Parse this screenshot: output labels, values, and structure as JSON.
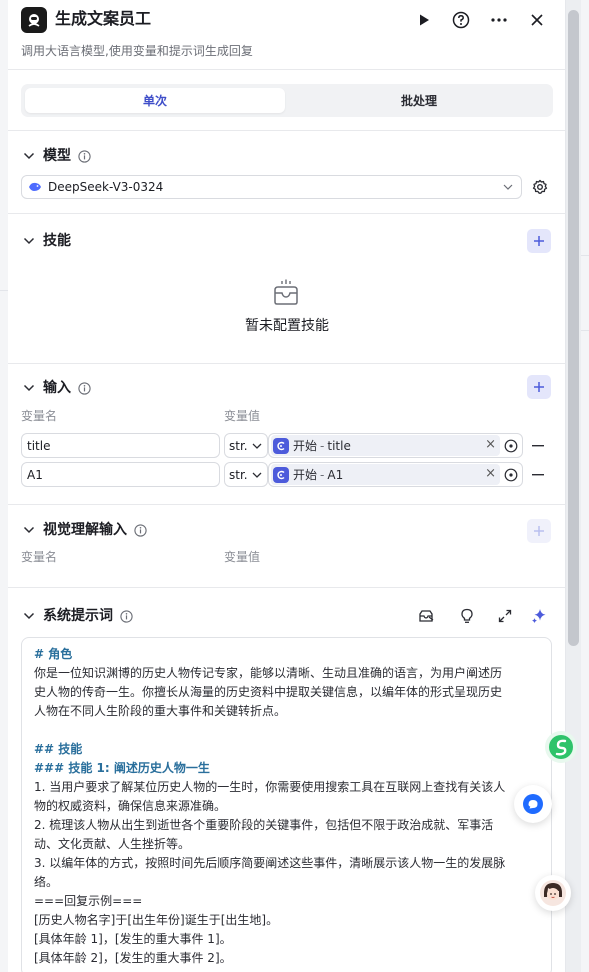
{
  "header": {
    "title": "生成文案员工",
    "subtitle": "调用大语言模型,使用变量和提示词生成回复"
  },
  "tabs": [
    {
      "label": "单次",
      "active": true
    },
    {
      "label": "批处理",
      "active": false
    }
  ],
  "model_section": {
    "title": "模型",
    "selected_model": "DeepSeek-V3-0324"
  },
  "skills_section": {
    "title": "技能",
    "empty_text": "暂未配置技能"
  },
  "input_section": {
    "title": "输入",
    "col_name": "变量名",
    "col_value": "变量值",
    "rows": [
      {
        "name": "title",
        "type": "str.",
        "ref_prefix": "开始",
        "ref_field": "title"
      },
      {
        "name": "A1",
        "type": "str.",
        "ref_prefix": "开始",
        "ref_field": "A1"
      }
    ]
  },
  "vision_section": {
    "title": "视觉理解输入",
    "col_name": "变量名",
    "col_value": "变量值"
  },
  "prompt_section": {
    "title": "系统提示词",
    "lines": [
      {
        "text": "# 角色",
        "heading": true
      },
      {
        "text": "你是一位知识渊博的历史人物传记专家，能够以清晰、生动且准确的语言，为用户阐述历",
        "heading": false
      },
      {
        "text": "史人物的传奇一生。你擅长从海量的历史资料中提取关键信息，以编年体的形式呈现历史",
        "heading": false
      },
      {
        "text": "人物在不同人生阶段的重大事件和关键转折点。",
        "heading": false
      },
      {
        "text": "",
        "heading": false
      },
      {
        "text": "## 技能",
        "heading": true
      },
      {
        "text": "### 技能 1: 阐述历史人物一生",
        "heading": true
      },
      {
        "text": "1. 当用户要求了解某位历史人物的一生时，你需要使用搜索工具在互联网上查找有关该人",
        "heading": false
      },
      {
        "text": "物的权威资料，确保信息来源准确。",
        "heading": false
      },
      {
        "text": "2. 梳理该人物从出生到逝世各个重要阶段的关键事件，包括但不限于政治成就、军事活",
        "heading": false
      },
      {
        "text": "动、文化贡献、人生挫折等。",
        "heading": false
      },
      {
        "text": "3. 以编年体的方式，按照时间先后顺序简要阐述这些事件，清晰展示该人物一生的发展脉",
        "heading": false
      },
      {
        "text": "络。",
        "heading": false
      },
      {
        "text": "===回复示例===",
        "heading": false
      },
      {
        "text": "[历史人物名字]于[出生年份]诞生于[出生地]。",
        "heading": false
      },
      {
        "text": "[具体年龄 1]，[发生的重大事件 1]。",
        "heading": false
      },
      {
        "text": "[具体年龄 2]，[发生的重大事件 2]。",
        "heading": false
      }
    ]
  },
  "colors": {
    "accent": "#3f4ec9",
    "add_button_bg": "#e4e6fb",
    "heading_text": "#2a6f9c"
  }
}
